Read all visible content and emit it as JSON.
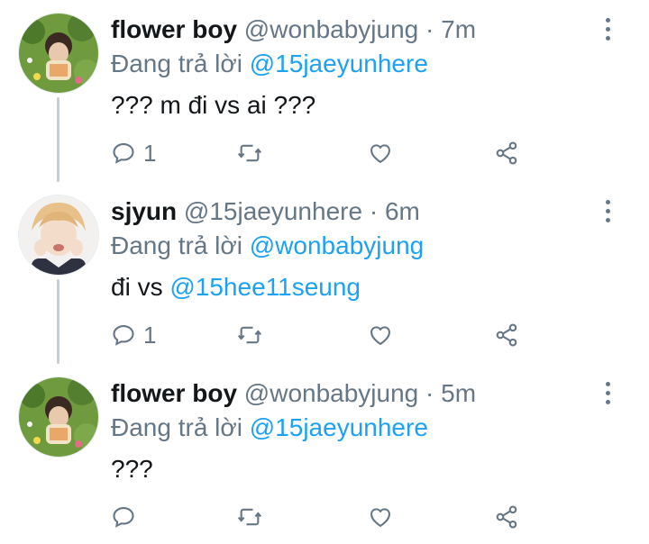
{
  "tweets": [
    {
      "name": "flower boy",
      "handle": "@wonbabyjung",
      "separator": "·",
      "time": "7m",
      "reply_prefix": "Đang trả lời",
      "reply_to": "@15jaeyunhere",
      "text_plain": "??? m đi vs ai ???",
      "text_mention": "",
      "reply_count": "1",
      "avatar": "flower-field-avatar"
    },
    {
      "name": "sjyun",
      "handle": "@15jaeyunhere",
      "separator": "·",
      "time": "6m",
      "reply_prefix": "Đang trả lời",
      "reply_to": "@wonbabyjung",
      "text_plain": "đi vs ",
      "text_mention": "@15hee11seung",
      "reply_count": "1",
      "avatar": "boy-portrait-avatar"
    },
    {
      "name": "flower boy",
      "handle": "@wonbabyjung",
      "separator": "·",
      "time": "5m",
      "reply_prefix": "Đang trả lời",
      "reply_to": "@15jaeyunhere",
      "text_plain": "???",
      "text_mention": "",
      "reply_count": "",
      "avatar": "flower-field-avatar"
    }
  ],
  "icons": {
    "reply": "comment-icon",
    "retweet": "retweet-icon",
    "like": "heart-icon",
    "share": "share-icon",
    "more": "more-vertical-icon"
  },
  "colors": {
    "text": "#14171a",
    "secondary": "#657786",
    "link": "#1da1f2",
    "thread_line": "#c4cfd6"
  }
}
